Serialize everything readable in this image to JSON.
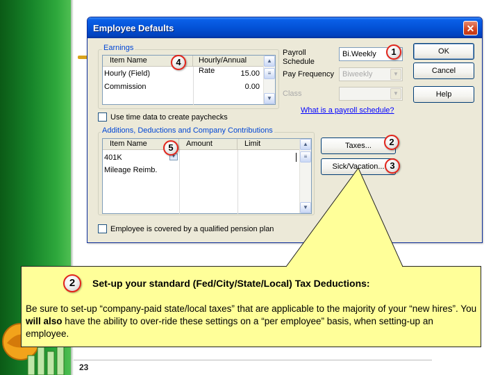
{
  "dialog": {
    "title": "Employee Defaults",
    "earnings": {
      "legend": "Earnings",
      "columns": [
        "Item Name",
        "Hourly/Annual Rate"
      ],
      "rows": [
        {
          "name": "Hourly (Field)",
          "rate": "15.00"
        },
        {
          "name": "Commission",
          "rate": "0.00"
        }
      ]
    },
    "payroll_schedule_label": "Payroll\nSchedule",
    "payroll_schedule_value": "Bi.Weekly",
    "pay_frequency_label": "Pay Frequency",
    "pay_frequency_value": "Biweekly",
    "class_label": "Class",
    "class_value": "",
    "schedule_link": "What is a payroll schedule?",
    "use_time_data_label": "Use time data to create paychecks",
    "additions": {
      "legend": "Additions, Deductions and Company Contributions",
      "columns": [
        "Item Name",
        "Amount",
        "Limit"
      ],
      "rows": [
        {
          "name": "401K",
          "amount": "",
          "limit": ""
        },
        {
          "name": "Mileage Reimb.",
          "amount": "",
          "limit": ""
        }
      ]
    },
    "pension_label": "Employee is covered by a qualified pension plan",
    "buttons": {
      "ok": "OK",
      "cancel": "Cancel",
      "help": "Help",
      "taxes": "Taxes...",
      "sick_vacation": "Sick/Vacation..."
    }
  },
  "badges": {
    "b1": "1",
    "b2": "2",
    "b3": "3",
    "b4": "4",
    "b5": "5"
  },
  "callout": {
    "badge": "2",
    "title": "Set-up your standard (Fed/City/State/Local) Tax Deductions:",
    "body_1": "Be sure to set-up “company-paid state/local taxes” that are applicable to the majority of your “new hires”. You ",
    "body_bold": "will also",
    "body_2": " have the ability to over-ride these settings on a “per employee” basis, when setting-up an employee."
  },
  "slide": {
    "page_number": "23"
  },
  "colors": {
    "accent_green": "#17852a",
    "titlebar_blue": "#0352d6",
    "callout_yellow": "#ffff99",
    "badge_red": "#e2231a",
    "link_blue": "#0000ff"
  },
  "icons": {
    "close": "close-icon",
    "dropdown": "chevron-down-icon",
    "scroll_up": "scroll-up-icon",
    "scroll_down": "scroll-down-icon"
  }
}
